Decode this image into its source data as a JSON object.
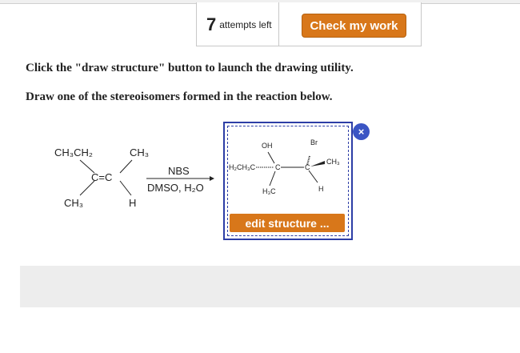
{
  "header": {
    "attempts_count": "7",
    "attempts_label": "attempts left",
    "check_button_label": "Check my work"
  },
  "instructions": {
    "line1": "Click the \"draw structure\" button to launch the drawing utility.",
    "line2": "Draw one of the stereoisomers formed in the reaction below."
  },
  "reaction": {
    "reagent": "NBS",
    "solvent": "DMSO, H₂O",
    "reactant_groups": {
      "top_left": "CH₃CH₂",
      "top_right": "CH₃",
      "center": "C=C",
      "bottom_left": "CH₃",
      "bottom_right": "H"
    }
  },
  "answer": {
    "oh_label": "OH",
    "br_label": "Br",
    "ch3_right": "CH₃",
    "ethyl_label": "H₂CH₃C",
    "c_label_left": "C",
    "c_label_right": "C",
    "h3c_label": "H₃C",
    "h_label": "H",
    "edit_button_label": "edit structure ...",
    "close_icon": "×"
  },
  "colors": {
    "accent_orange": "#d8771a",
    "answer_border": "#2d3ea6"
  }
}
